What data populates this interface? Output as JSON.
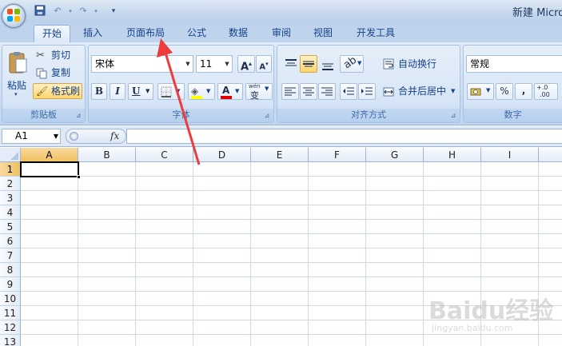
{
  "app": {
    "window_title": "新建 Micro"
  },
  "tabs": [
    {
      "label": "开始",
      "active": true
    },
    {
      "label": "插入"
    },
    {
      "label": "页面布局"
    },
    {
      "label": "公式"
    },
    {
      "label": "数据"
    },
    {
      "label": "审阅"
    },
    {
      "label": "视图"
    },
    {
      "label": "开发工具"
    }
  ],
  "clipboard": {
    "paste_label": "粘贴",
    "cut_label": "剪切",
    "copy_label": "复制",
    "format_painter_label": "格式刷",
    "group_label": "剪贴板"
  },
  "font": {
    "font_name": "宋体",
    "font_size": "11",
    "bold": "B",
    "italic": "I",
    "underline": "U",
    "grow": "A",
    "shrink": "A",
    "font_color_glyph": "A",
    "phonetic_glyph": "wén",
    "phonetic_char": "变",
    "group_label": "字体"
  },
  "alignment": {
    "wrap_text_label": "自动换行",
    "merge_center_label": "合并后居中",
    "group_label": "对齐方式"
  },
  "number": {
    "format_value": "常规",
    "percent": "%",
    "comma": ",",
    "increase_decimal_top": "+.0",
    "increase_decimal_bottom": ".00",
    "group_label": "数字"
  },
  "formula_bar": {
    "name_box": "A1",
    "fx": "fx",
    "formula": ""
  },
  "grid": {
    "columns": [
      "A",
      "B",
      "C",
      "D",
      "E",
      "F",
      "G",
      "H",
      "I"
    ],
    "rows": [
      "1",
      "2",
      "3",
      "4",
      "5",
      "6",
      "7",
      "8",
      "9",
      "10",
      "11",
      "12",
      "13"
    ],
    "selected_cell": "A1"
  },
  "colors": {
    "accent": "#15428b",
    "selection_header": "#f1c15f",
    "annotation_arrow": "#ee3b3b",
    "font_color_bar": "#e00000",
    "fill_color_bar": "#ffff00"
  },
  "watermark": {
    "logo": "Baidu经验",
    "sub": "jingyan.baidu.com"
  }
}
